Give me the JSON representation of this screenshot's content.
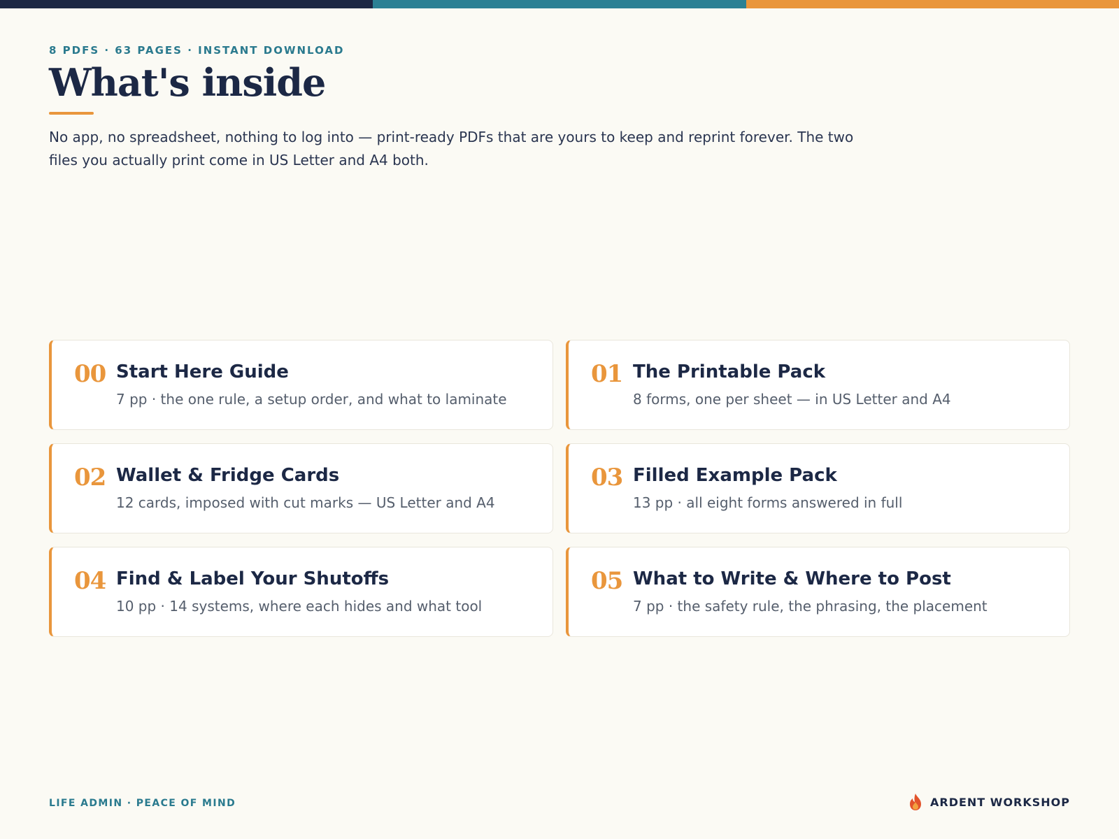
{
  "header": {
    "eyebrow": "8 PDFS · 63 PAGES · INSTANT DOWNLOAD",
    "title": "What's inside",
    "lede": "No app, no spreadsheet, nothing to log into — print-ready PDFs that are yours to keep and reprint forever. The two files you actually print come in US Letter and A4 both."
  },
  "items": [
    {
      "num": "00",
      "title": "Start Here Guide",
      "desc": "7 pp · the one rule, a setup order, and what to laminate"
    },
    {
      "num": "01",
      "title": "The Printable Pack",
      "desc": "8 forms, one per sheet — in US Letter and A4"
    },
    {
      "num": "02",
      "title": "Wallet & Fridge Cards",
      "desc": "12 cards, imposed with cut marks — US Letter and A4"
    },
    {
      "num": "03",
      "title": "Filled Example Pack",
      "desc": "13 pp · all eight forms answered in full"
    },
    {
      "num": "04",
      "title": "Find & Label Your Shutoffs",
      "desc": "10 pp · 14 systems, where each hides and what tool"
    },
    {
      "num": "05",
      "title": "What to Write & Where to Post",
      "desc": "7 pp · the safety rule, the phrasing, the placement"
    }
  ],
  "footer": {
    "tagline": "LIFE ADMIN · PEACE OF MIND",
    "brand": "ARDENT WORKSHOP",
    "brand_icon": "flame-icon"
  },
  "colors": {
    "navy": "#1c2845",
    "teal": "#2b8194",
    "orange": "#e9963c",
    "background": "#fbfaf4"
  }
}
